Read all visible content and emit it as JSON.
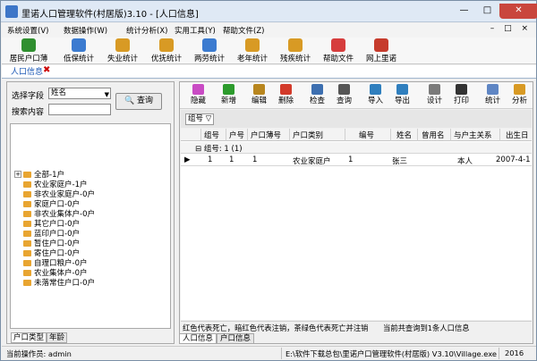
{
  "window": {
    "title": "里诺人口管理软件(村居版)3.10 - [人口信息]",
    "minimize": "—",
    "maximize": "□",
    "close": "✕"
  },
  "menu": {
    "items": [
      "系统设置(V)",
      "数据操作(W)",
      "统计分析(X)",
      "实用工具(Y)",
      "帮助文件(Z)"
    ],
    "mdi_controls": "– □ ×"
  },
  "toolbar": {
    "items": [
      {
        "label": "居民户口薄",
        "icon": "person-add-icon",
        "color": "#2f8f2f"
      },
      {
        "label": "低保统计",
        "icon": "chart-icon",
        "color": "#3b7bd0"
      },
      {
        "label": "失业统计",
        "icon": "toolbox-icon",
        "color": "#d89a24"
      },
      {
        "label": "优抚统计",
        "icon": "toolbox-icon",
        "color": "#d89a24"
      },
      {
        "label": "两劳统计",
        "icon": "chart-icon",
        "color": "#3b7bd0"
      },
      {
        "label": "老年统计",
        "icon": "toolbox-icon",
        "color": "#d89a24"
      },
      {
        "label": "残疾统计",
        "icon": "toolbox-icon",
        "color": "#d89a24"
      },
      {
        "label": "帮助文件",
        "icon": "help-icon",
        "color": "#d63d3d"
      },
      {
        "label": "网上里诺",
        "icon": "house-icon",
        "color": "#c63b2c"
      }
    ]
  },
  "doc_tab": {
    "label": "人口信息",
    "close": "✖"
  },
  "search": {
    "field_label": "选择字段",
    "field_value": "姓名",
    "content_label": "搜索内容",
    "content_value": "",
    "button": "查询"
  },
  "tree": {
    "expand": "+",
    "items": [
      "全部-1户",
      "农业家庭户-1户",
      "非农业家庭户-0户",
      "家庭户口-0户",
      "非农业集体户-0户",
      "其它户口-0户",
      "蓝印户口-0户",
      "暂住户口-0户",
      "寄住户口-0户",
      "自理口粮户-0户",
      "农业集体户-0户",
      "未落常住户口-0户"
    ]
  },
  "left_tabs": [
    "户口类型",
    "年龄"
  ],
  "right_toolbar": [
    {
      "label": "隐藏",
      "icon": "hide-icon",
      "color": "#c94bc4"
    },
    {
      "label": "新增",
      "icon": "plus-icon",
      "color": "#2c9b2c"
    },
    {
      "label": "编辑",
      "icon": "edit-icon",
      "color": "#b8861e"
    },
    {
      "label": "删除",
      "icon": "delete-icon",
      "color": "#d33a2a"
    },
    {
      "label": "检查",
      "icon": "save-icon",
      "color": "#3d6fb0"
    },
    {
      "label": "查询",
      "icon": "binoculars-icon",
      "color": "#555555"
    },
    {
      "label": "导入",
      "icon": "import-icon",
      "color": "#2f7fbe"
    },
    {
      "label": "导出",
      "icon": "export-icon",
      "color": "#2f7fbe"
    },
    {
      "label": "设计",
      "icon": "design-icon",
      "color": "#7a7a7a"
    },
    {
      "label": "打印",
      "icon": "print-icon",
      "color": "#333333"
    },
    {
      "label": "统计",
      "icon": "stats-icon",
      "color": "#5f86c4"
    },
    {
      "label": "分析",
      "icon": "analysis-icon",
      "color": "#d89a24"
    }
  ],
  "group_chip": "组号 ▽",
  "grid": {
    "columns": [
      "组号",
      "户号",
      "户口薄号",
      "户口类别",
      "编号",
      "姓名",
      "曾用名",
      "与户主关系",
      "出生日"
    ],
    "group_row": "⊟ 组号: 1 (1)",
    "row_marker": "▶",
    "rows": [
      [
        "1",
        "1",
        "1",
        "农业家庭户",
        "1",
        "张三",
        "",
        "本人",
        "2007-4-1"
      ]
    ]
  },
  "legend_text": "红色代表死亡，暗红色代表注销，茶绿色代表死亡并注销",
  "count_text": "当前共查询到1条人口信息",
  "right_tabs": [
    "人口信息",
    "户口信息"
  ],
  "status": {
    "operator": "当前操作员: admin",
    "path": "E:\\软件下载总包\\里诺户口管理软件(村居版) V3.10\\Village.exe",
    "year": "2016"
  }
}
